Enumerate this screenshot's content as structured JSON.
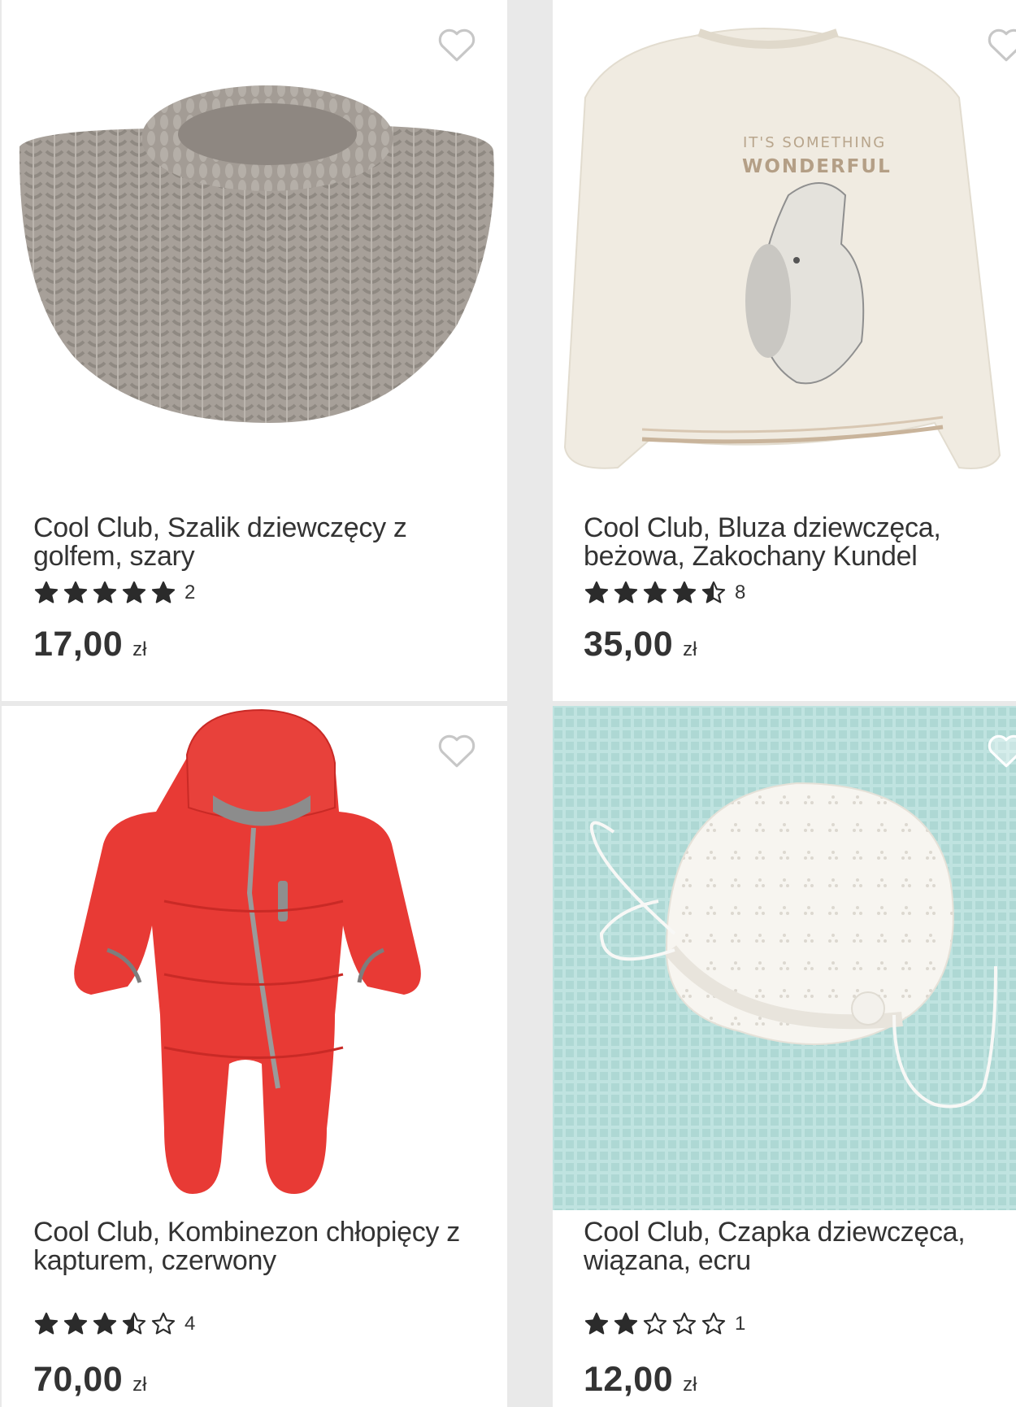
{
  "products": [
    {
      "title": "Cool Club, Szalik dziewczęcy z golfem, szary",
      "rating": 5,
      "review_count": "2",
      "price": "17,00",
      "currency": "zł",
      "wishlist_icon": "heart-outline-icon",
      "image_color": "#a9a29b"
    },
    {
      "title": "Cool Club, Bluza dziewczęca, beżowa, Zakochany Kundel",
      "rating": 4.5,
      "review_count": "8",
      "price": "35,00",
      "currency": "zł",
      "wishlist_icon": "heart-outline-icon",
      "image_color": "#efebe0",
      "image_text_line1": "IT'S SOMETHING",
      "image_text_line2": "WONDERFUL"
    },
    {
      "title": "Cool Club, Kombinezon chłopięcy z kapturem, czerwony",
      "rating": 3.5,
      "review_count": "4",
      "price": "70,00",
      "currency": "zł",
      "wishlist_icon": "heart-outline-icon",
      "image_color": "#e8332f"
    },
    {
      "title": "Cool Club, Czapka dziewczęca, wiązana, ecru",
      "rating": 2,
      "review_count": "1",
      "price": "12,00",
      "currency": "zł",
      "wishlist_icon": "heart-outline-icon",
      "image_color": "#bfe3e0"
    }
  ],
  "colors": {
    "text": "#333333",
    "star": "#2b2b2b",
    "card_background": "#ffffff",
    "page_background": "#e9e9e9"
  }
}
